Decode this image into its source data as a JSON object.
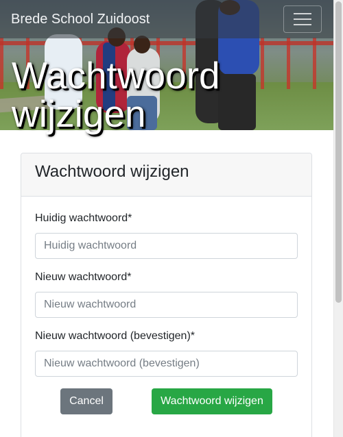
{
  "navbar": {
    "brand": "Brede School Zuidoost",
    "toggler_icon": "hamburger-menu-icon"
  },
  "hero": {
    "title": "Wachtwoord wijzigen"
  },
  "card": {
    "header": "Wachtwoord wijzigen",
    "fields": [
      {
        "label": "Huidig wachtwoord*",
        "placeholder": "Huidig wachtwoord",
        "value": ""
      },
      {
        "label": "Nieuw wachtwoord*",
        "placeholder": "Nieuw wachtwoord",
        "value": ""
      },
      {
        "label": "Nieuw wachtwoord (bevestigen)*",
        "placeholder": "Nieuw wachtwoord (bevestigen)",
        "value": ""
      }
    ],
    "cancel_label": "Cancel",
    "submit_label": "Wachtwoord wijzigen"
  },
  "colors": {
    "cancel_button": "#6c757d",
    "submit_button": "#28a745",
    "navbar": "#343a40"
  }
}
